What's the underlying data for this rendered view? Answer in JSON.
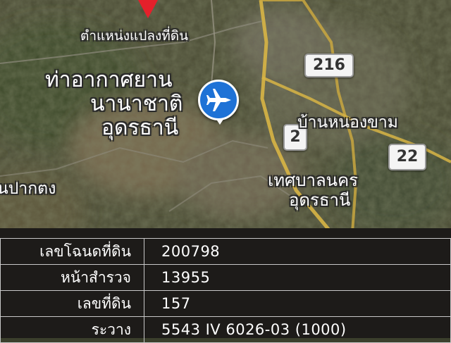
{
  "map": {
    "labels": {
      "parcel_position": "ตำแหน่งแปลงที่ดิน",
      "airport_line1": "ท่าอากาศยาน",
      "airport_line2": "นานาชาติ",
      "airport_line3": "อุดรธานี",
      "ban_nong_kham": "บ้านหนองขาม",
      "tessaban_line1": "เทศบาลนคร",
      "tessaban_line2": "อุดรธานี",
      "ban_pak_tong": "นปากตง"
    },
    "shields": {
      "route_216": "216",
      "route_2": "2",
      "route_22": "22"
    },
    "icons": {
      "airport": "airplane-icon",
      "parcel_pin": "map-pin-icon"
    }
  },
  "info_panel": {
    "rows": [
      {
        "key": "เลขโฉนดที่ดิน",
        "value": "200798"
      },
      {
        "key": "หน้าสำรวจ",
        "value": "13955"
      },
      {
        "key": "เลขที่ดิน",
        "value": "157"
      },
      {
        "key": "ระวาง",
        "value": "5543 IV 6026-03 (1000)"
      }
    ]
  },
  "colors": {
    "panel_bg": "#1d1b19",
    "airport_blue": "#1e72d6",
    "pin_red": "#e5202b",
    "road_yellow": "#d8b545"
  }
}
